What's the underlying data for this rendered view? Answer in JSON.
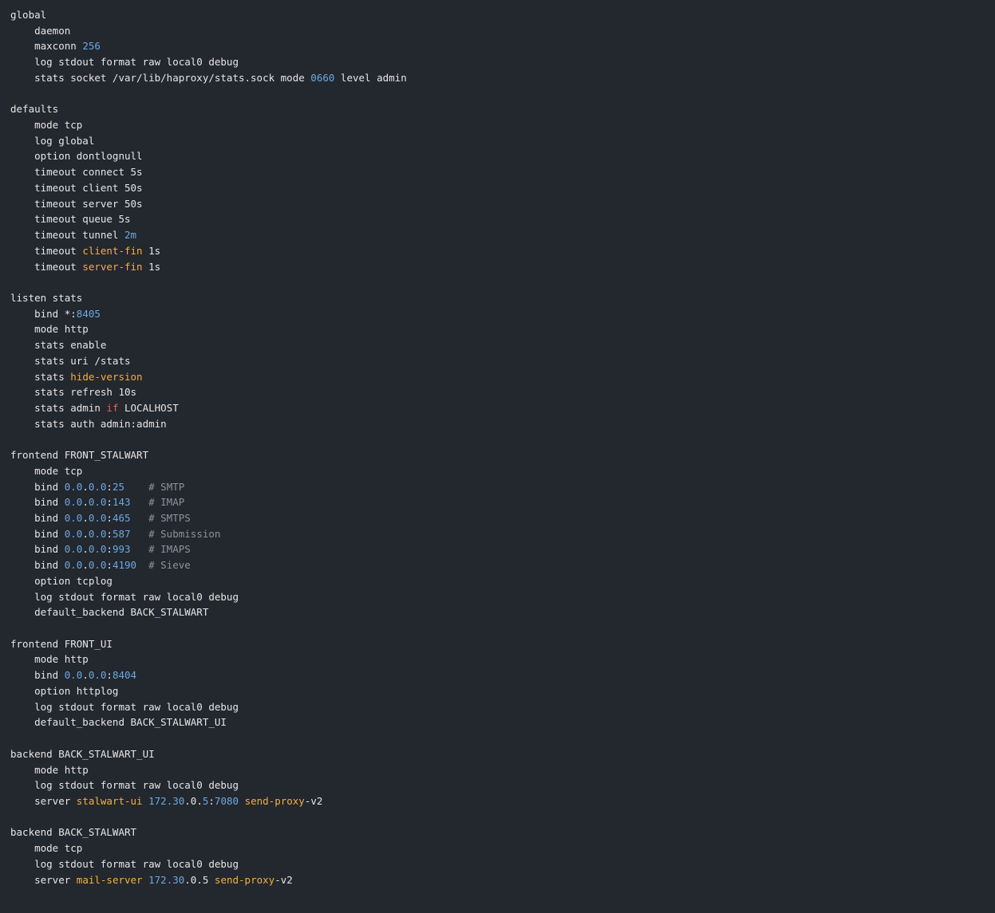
{
  "code_block": {
    "colors": {
      "background": "#23272e",
      "plain": "#e6e6e6",
      "number": "#6ca9e0",
      "keyword": "#f3b13d",
      "conditional": "#ec5f4f",
      "comment": "#8c939e"
    },
    "lines": [
      [
        {
          "text": "global",
          "kind": "plain"
        }
      ],
      [
        {
          "text": "    daemon",
          "kind": "plain"
        }
      ],
      [
        {
          "text": "    maxconn ",
          "kind": "plain"
        },
        {
          "text": "256",
          "kind": "num"
        }
      ],
      [
        {
          "text": "    log stdout format raw local0 debug",
          "kind": "plain"
        }
      ],
      [
        {
          "text": "    stats socket /var/lib/haproxy/stats.sock mode ",
          "kind": "plain"
        },
        {
          "text": "0660",
          "kind": "num"
        },
        {
          "text": " level admin",
          "kind": "plain"
        }
      ],
      [],
      [
        {
          "text": "defaults",
          "kind": "plain"
        }
      ],
      [
        {
          "text": "    mode tcp",
          "kind": "plain"
        }
      ],
      [
        {
          "text": "    log global",
          "kind": "plain"
        }
      ],
      [
        {
          "text": "    option dontlognull",
          "kind": "plain"
        }
      ],
      [
        {
          "text": "    timeout connect 5s",
          "kind": "plain"
        }
      ],
      [
        {
          "text": "    timeout client 50s",
          "kind": "plain"
        }
      ],
      [
        {
          "text": "    timeout server 50s",
          "kind": "plain"
        }
      ],
      [
        {
          "text": "    timeout queue 5s",
          "kind": "plain"
        }
      ],
      [
        {
          "text": "    timeout tunnel ",
          "kind": "plain"
        },
        {
          "text": "2m",
          "kind": "num"
        }
      ],
      [
        {
          "text": "    timeout ",
          "kind": "plain"
        },
        {
          "text": "client-fin",
          "kind": "kw"
        },
        {
          "text": " 1s",
          "kind": "plain"
        }
      ],
      [
        {
          "text": "    timeout ",
          "kind": "plain"
        },
        {
          "text": "server-fin",
          "kind": "kw"
        },
        {
          "text": " 1s",
          "kind": "plain"
        }
      ],
      [],
      [
        {
          "text": "listen stats",
          "kind": "plain"
        }
      ],
      [
        {
          "text": "    bind *:",
          "kind": "plain"
        },
        {
          "text": "8405",
          "kind": "num"
        }
      ],
      [
        {
          "text": "    mode http",
          "kind": "plain"
        }
      ],
      [
        {
          "text": "    stats enable",
          "kind": "plain"
        }
      ],
      [
        {
          "text": "    stats uri /stats",
          "kind": "plain"
        }
      ],
      [
        {
          "text": "    stats ",
          "kind": "plain"
        },
        {
          "text": "hide-version",
          "kind": "kw"
        }
      ],
      [
        {
          "text": "    stats refresh 10s",
          "kind": "plain"
        }
      ],
      [
        {
          "text": "    stats admin ",
          "kind": "plain"
        },
        {
          "text": "if",
          "kind": "cond"
        },
        {
          "text": " LOCALHOST",
          "kind": "plain"
        }
      ],
      [
        {
          "text": "    stats auth admin:admin",
          "kind": "plain"
        }
      ],
      [],
      [
        {
          "text": "frontend FRONT_STALWART",
          "kind": "plain"
        }
      ],
      [
        {
          "text": "    mode tcp",
          "kind": "plain"
        }
      ],
      [
        {
          "text": "    bind ",
          "kind": "plain"
        },
        {
          "text": "0.0",
          "kind": "num"
        },
        {
          "text": ".",
          "kind": "plain"
        },
        {
          "text": "0.0",
          "kind": "num"
        },
        {
          "text": ":",
          "kind": "plain"
        },
        {
          "text": "25",
          "kind": "num"
        },
        {
          "text": "    ",
          "kind": "plain"
        },
        {
          "text": "# SMTP",
          "kind": "comment"
        }
      ],
      [
        {
          "text": "    bind ",
          "kind": "plain"
        },
        {
          "text": "0.0",
          "kind": "num"
        },
        {
          "text": ".",
          "kind": "plain"
        },
        {
          "text": "0.0",
          "kind": "num"
        },
        {
          "text": ":",
          "kind": "plain"
        },
        {
          "text": "143",
          "kind": "num"
        },
        {
          "text": "   ",
          "kind": "plain"
        },
        {
          "text": "# IMAP",
          "kind": "comment"
        }
      ],
      [
        {
          "text": "    bind ",
          "kind": "plain"
        },
        {
          "text": "0.0",
          "kind": "num"
        },
        {
          "text": ".",
          "kind": "plain"
        },
        {
          "text": "0.0",
          "kind": "num"
        },
        {
          "text": ":",
          "kind": "plain"
        },
        {
          "text": "465",
          "kind": "num"
        },
        {
          "text": "   ",
          "kind": "plain"
        },
        {
          "text": "# SMTPS",
          "kind": "comment"
        }
      ],
      [
        {
          "text": "    bind ",
          "kind": "plain"
        },
        {
          "text": "0.0",
          "kind": "num"
        },
        {
          "text": ".",
          "kind": "plain"
        },
        {
          "text": "0.0",
          "kind": "num"
        },
        {
          "text": ":",
          "kind": "plain"
        },
        {
          "text": "587",
          "kind": "num"
        },
        {
          "text": "   ",
          "kind": "plain"
        },
        {
          "text": "# Submission",
          "kind": "comment"
        }
      ],
      [
        {
          "text": "    bind ",
          "kind": "plain"
        },
        {
          "text": "0.0",
          "kind": "num"
        },
        {
          "text": ".",
          "kind": "plain"
        },
        {
          "text": "0.0",
          "kind": "num"
        },
        {
          "text": ":",
          "kind": "plain"
        },
        {
          "text": "993",
          "kind": "num"
        },
        {
          "text": "   ",
          "kind": "plain"
        },
        {
          "text": "# IMAPS",
          "kind": "comment"
        }
      ],
      [
        {
          "text": "    bind ",
          "kind": "plain"
        },
        {
          "text": "0.0",
          "kind": "num"
        },
        {
          "text": ".",
          "kind": "plain"
        },
        {
          "text": "0.0",
          "kind": "num"
        },
        {
          "text": ":",
          "kind": "plain"
        },
        {
          "text": "4190",
          "kind": "num"
        },
        {
          "text": "  ",
          "kind": "plain"
        },
        {
          "text": "# Sieve",
          "kind": "comment"
        }
      ],
      [
        {
          "text": "    option tcplog",
          "kind": "plain"
        }
      ],
      [
        {
          "text": "    log stdout format raw local0 debug",
          "kind": "plain"
        }
      ],
      [
        {
          "text": "    default_backend BACK_STALWART",
          "kind": "plain"
        }
      ],
      [],
      [
        {
          "text": "frontend FRONT_UI",
          "kind": "plain"
        }
      ],
      [
        {
          "text": "    mode http",
          "kind": "plain"
        }
      ],
      [
        {
          "text": "    bind ",
          "kind": "plain"
        },
        {
          "text": "0.0",
          "kind": "num"
        },
        {
          "text": ".",
          "kind": "plain"
        },
        {
          "text": "0.0",
          "kind": "num"
        },
        {
          "text": ":",
          "kind": "plain"
        },
        {
          "text": "8404",
          "kind": "num"
        }
      ],
      [
        {
          "text": "    option httplog",
          "kind": "plain"
        }
      ],
      [
        {
          "text": "    log stdout format raw local0 debug",
          "kind": "plain"
        }
      ],
      [
        {
          "text": "    default_backend BACK_STALWART_UI",
          "kind": "plain"
        }
      ],
      [],
      [
        {
          "text": "backend BACK_STALWART_UI",
          "kind": "plain"
        }
      ],
      [
        {
          "text": "    mode http",
          "kind": "plain"
        }
      ],
      [
        {
          "text": "    log stdout format raw local0 debug",
          "kind": "plain"
        }
      ],
      [
        {
          "text": "    server ",
          "kind": "plain"
        },
        {
          "text": "stalwart-ui",
          "kind": "kw"
        },
        {
          "text": " ",
          "kind": "plain"
        },
        {
          "text": "172.30",
          "kind": "num"
        },
        {
          "text": ".0.",
          "kind": "plain"
        },
        {
          "text": "5",
          "kind": "num"
        },
        {
          "text": ":",
          "kind": "plain"
        },
        {
          "text": "7080",
          "kind": "num"
        },
        {
          "text": " ",
          "kind": "plain"
        },
        {
          "text": "send-proxy",
          "kind": "kw"
        },
        {
          "text": "-v2",
          "kind": "plain"
        }
      ],
      [],
      [
        {
          "text": "backend BACK_STALWART",
          "kind": "plain"
        }
      ],
      [
        {
          "text": "    mode tcp",
          "kind": "plain"
        }
      ],
      [
        {
          "text": "    log stdout format raw local0 debug",
          "kind": "plain"
        }
      ],
      [
        {
          "text": "    server ",
          "kind": "plain"
        },
        {
          "text": "mail-server",
          "kind": "kw"
        },
        {
          "text": " ",
          "kind": "plain"
        },
        {
          "text": "172.30",
          "kind": "num"
        },
        {
          "text": ".0.5 ",
          "kind": "plain"
        },
        {
          "text": "send-proxy",
          "kind": "kw"
        },
        {
          "text": "-v2",
          "kind": "plain"
        }
      ]
    ]
  }
}
